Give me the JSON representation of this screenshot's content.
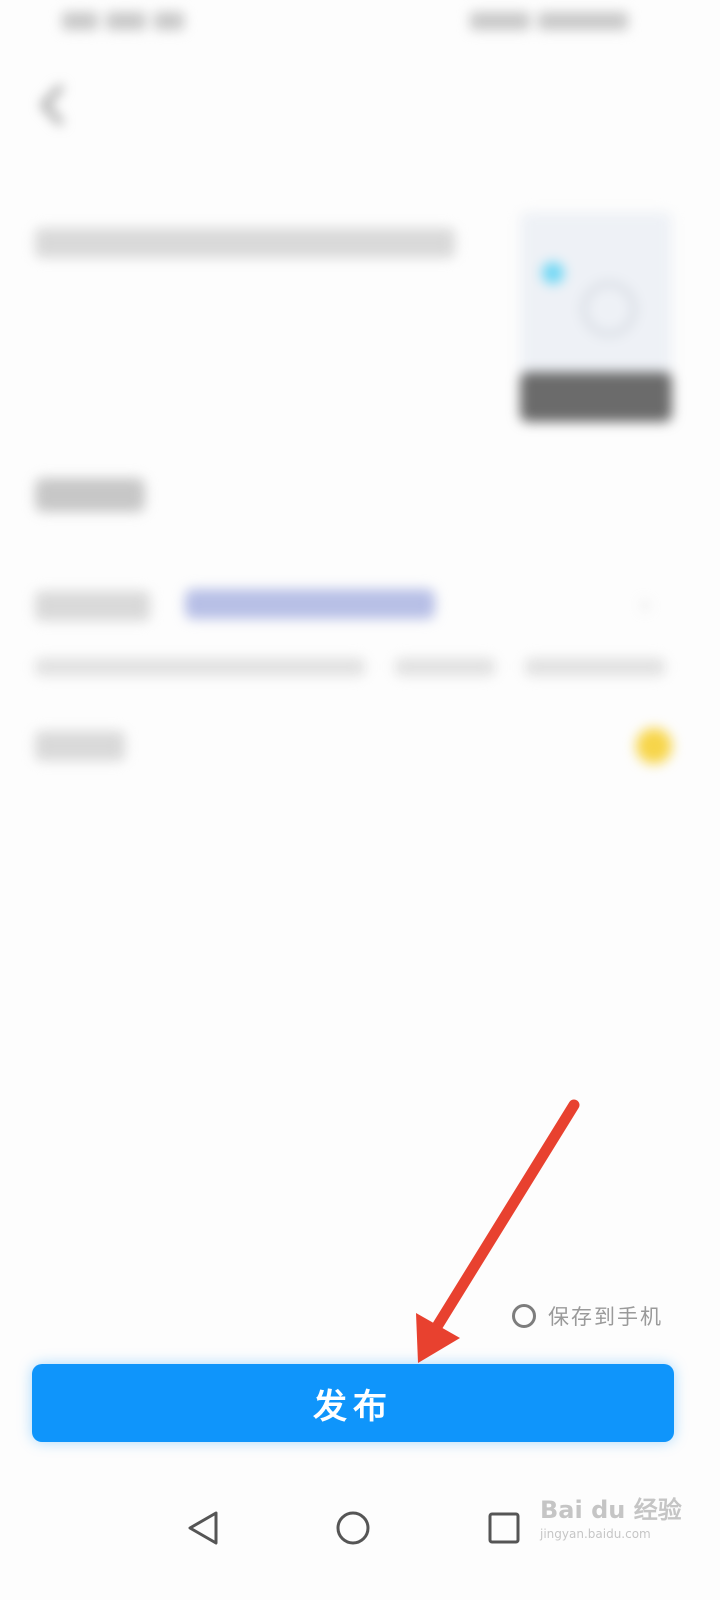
{
  "save_to_phone": {
    "label": "保存到手机",
    "checked": false
  },
  "publish_button": {
    "label": "发布",
    "color": "#0f95fb"
  },
  "annotation": {
    "arrow_color": "#e8412f"
  },
  "watermark": {
    "brand": "Bai du 经验",
    "url": "jingyan.baidu.com"
  },
  "icons": {
    "back": "chevron-left-icon",
    "nav_back": "triangle-back-icon",
    "nav_home": "circle-home-icon",
    "nav_recents": "square-recents-icon"
  }
}
